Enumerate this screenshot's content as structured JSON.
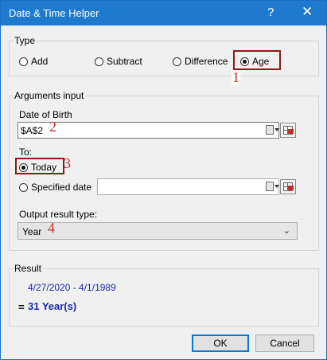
{
  "window": {
    "title": "Date & Time Helper",
    "help": "?",
    "close": "✕"
  },
  "type": {
    "legend": "Type",
    "options": [
      {
        "label": "Add",
        "selected": false
      },
      {
        "label": "Subtract",
        "selected": false
      },
      {
        "label": "Difference",
        "selected": false
      },
      {
        "label": "Age",
        "selected": true
      }
    ]
  },
  "arguments": {
    "legend": "Arguments input",
    "dob_label": "Date of Birth",
    "dob_value": "$A$2",
    "to_label": "To:",
    "today_label": "Today",
    "today_selected": true,
    "specified_label": "Specified date",
    "specified_value": "",
    "output_label": "Output result type:",
    "output_value": "Year"
  },
  "result": {
    "legend": "Result",
    "formula": "4/27/2020 - 4/1/1989",
    "equals": "=",
    "value": "31 Year(s)"
  },
  "buttons": {
    "ok": "OK",
    "cancel": "Cancel"
  },
  "callouts": [
    "1",
    "2",
    "3",
    "4"
  ],
  "colors": {
    "titlebar": "#1e79cf",
    "callout": "#c0302a",
    "result": "#1a2aa8"
  }
}
